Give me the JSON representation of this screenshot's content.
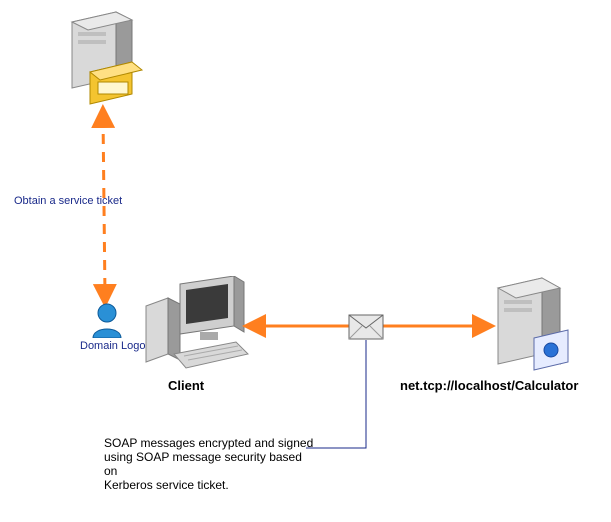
{
  "labels": {
    "obtain_ticket": "Obtain a service ticket",
    "domain_logon": "Domain Logon",
    "client": "Client",
    "service_url": "net.tcp://localhost/Calculator",
    "soap_note_l1": "SOAP messages encrypted and signed",
    "soap_note_l2": "using SOAP message security based on",
    "soap_note_l3": "Kerberos service ticket."
  },
  "colors": {
    "arrow": "#ff7f1f",
    "leader": "#1a2a8a",
    "server_body": "#d9d9d9",
    "server_shadow": "#9a9a9a",
    "folder": "#f4c430",
    "monitor": "#cfcfcf",
    "user": "#2a90d6",
    "envelope_fill": "#e8e8e8",
    "disc": "#2a72d6"
  }
}
